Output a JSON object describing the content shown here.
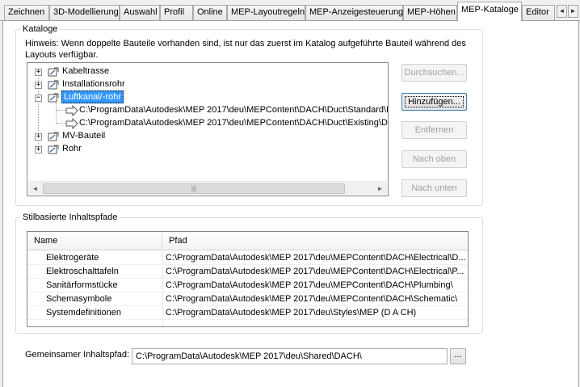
{
  "tabs": [
    {
      "label": "Zeichnen",
      "active": false
    },
    {
      "label": "3D-Modellierung",
      "active": false
    },
    {
      "label": "Auswahl",
      "active": false
    },
    {
      "label": "Profil",
      "active": false
    },
    {
      "label": "Online",
      "active": false
    },
    {
      "label": "MEP-Layoutregeln",
      "active": false
    },
    {
      "label": "MEP-Anzeigesteuerung",
      "active": false
    },
    {
      "label": "MEP-Höhen",
      "active": false
    },
    {
      "label": "MEP-Kataloge",
      "active": true
    },
    {
      "label": "Editor",
      "active": false
    }
  ],
  "tab_scroll": {
    "left": "◄",
    "right": "►"
  },
  "catalogs": {
    "group_title": "Kataloge",
    "hint": "Hinweis: Wenn doppelte Bauteile vorhanden sind, ist nur das zuerst im Katalog aufgeführte Bauteil während des Layouts verfügbar.",
    "tree": [
      {
        "label": "Kabeltrasse",
        "expander": "+"
      },
      {
        "label": "Installationsrohr",
        "expander": "+"
      },
      {
        "label": "Luftkanal/-rohr",
        "expander": "−",
        "selected": true
      },
      {
        "label": "C:\\ProgramData\\Autodesk\\MEP 2017\\deu\\MEPContent\\DACH\\Duct\\Standard\\Du"
      },
      {
        "label": "C:\\ProgramData\\Autodesk\\MEP 2017\\deu\\MEPContent\\DACH\\Duct\\Existing\\Duc"
      },
      {
        "label": "MV-Bauteil",
        "expander": "+"
      },
      {
        "label": "Rohr",
        "expander": "+"
      }
    ],
    "scrollbar": {
      "left": "◄",
      "right": "►",
      "grip": "|||"
    },
    "buttons": {
      "browse": "Durchsuchen...",
      "add": "Hinzufügen...",
      "remove": "Entfernen",
      "up": "Nach oben",
      "down": "Nach unten"
    }
  },
  "style_paths": {
    "group_title": "Stilbasierte Inhaltspfade",
    "columns": [
      "Name",
      "Pfad"
    ],
    "rows": [
      {
        "name": "Elektrogeräte",
        "path": "C:\\ProgramData\\Autodesk\\MEP 2017\\deu\\MEPContent\\DACH\\Electrical\\D..."
      },
      {
        "name": "Elektroschalttafeln",
        "path": "C:\\ProgramData\\Autodesk\\MEP 2017\\deu\\MEPContent\\DACH\\Electrical\\P..."
      },
      {
        "name": "Sanitärformstücke",
        "path": "C:\\ProgramData\\Autodesk\\MEP 2017\\deu\\MEPContent\\DACH\\Plumbing\\"
      },
      {
        "name": "Schemasymbole",
        "path": "C:\\ProgramData\\Autodesk\\MEP 2017\\deu\\MEPContent\\DACH\\Schematic\\"
      },
      {
        "name": "Systemdefinitionen",
        "path": "C:\\ProgramData\\Autodesk\\MEP 2017\\deu\\Styles\\MEP (D A CH)"
      }
    ]
  },
  "shared": {
    "label": "Gemeinsamer Inhaltspfad:",
    "value": "C:\\ProgramData\\Autodesk\\MEP 2017\\deu\\Shared\\DACH\\",
    "browse": "..."
  }
}
